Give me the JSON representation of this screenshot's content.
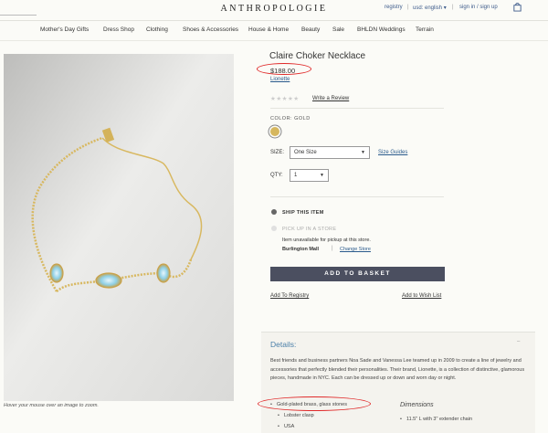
{
  "header": {
    "logo": "ANTHROPOLOGIE",
    "registry": "registry",
    "currency": "usd: english ▾",
    "sign_in": "sign in / sign up",
    "bag_icon": "shopping-bag-icon"
  },
  "nav": {
    "items": [
      "Mother's Day Gifts",
      "Dress Shop",
      "Clothing",
      "Shoes & Accessories",
      "House & Home",
      "Beauty",
      "Sale",
      "BHLDN Weddings",
      "Terrain"
    ]
  },
  "product": {
    "title": "Claire Choker Necklace",
    "price": "$188.00",
    "brand": "Lionette",
    "rating_stars": "★★★★★",
    "write_review": "Write a Review",
    "color_label": "COLOR: GOLD",
    "swatch_color": "#d6b75d",
    "size_label": "SIZE:",
    "size_value": "One Size",
    "size_guides": "Size Guides",
    "qty_label": "QTY:",
    "qty_value": "1",
    "hover_note": "Hover your mouse over an image to zoom."
  },
  "fulfillment": {
    "ship_label": "SHIP THIS ITEM",
    "pickup_label": "PICK UP IN A STORE",
    "unavailable": "Item unavailable for pickup at this store.",
    "store_name": "Burlington Mall",
    "store_sep": "|",
    "change_store": "Change Store"
  },
  "actions": {
    "add_to_basket": "ADD TO BASKET",
    "add_to_registry": "Add To Registry",
    "add_to_wishlist": "Add to Wish List"
  },
  "details": {
    "heading": "Details:",
    "toggle": "–",
    "description": "Best friends and business partners Noa Sade and Vanessa Lee teamed up in 2009 to create a line of jewelry and accessories that perfectly blended their personalities. Their brand, Lionette, is a collection of distinctive, glamorous pieces, handmade in NYC. Each can be dressed up or down and worn day or night.",
    "bullets": [
      "Gold-plated brass, glass stones"
    ],
    "sub_bullets": [
      "Lobster clasp",
      "USA"
    ],
    "dimensions_heading": "Dimensions",
    "dimensions": [
      "11.5\" L with 3\" extender chain"
    ]
  }
}
